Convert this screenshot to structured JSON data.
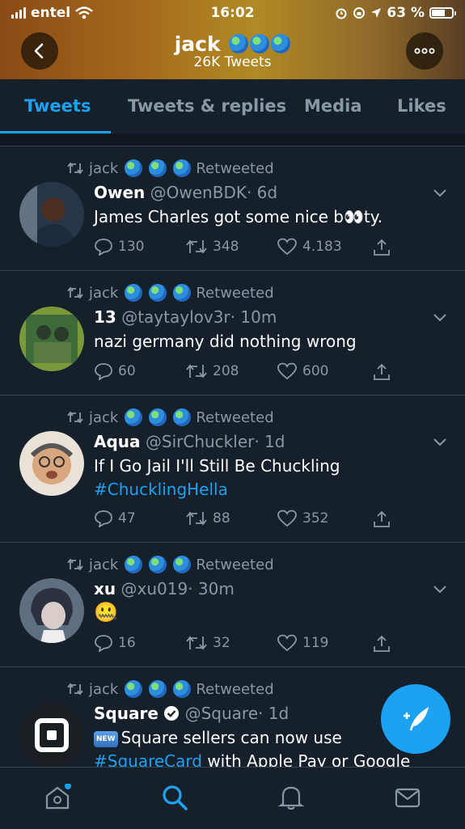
{
  "status_bar": {
    "carrier": "entel",
    "time": "16:02",
    "battery": "63 %"
  },
  "profile": {
    "name": "jack",
    "tweet_count": "26K Tweets"
  },
  "tabs": [
    "Tweets",
    "Tweets & replies",
    "Media",
    "Likes"
  ],
  "active_tab": "Tweets",
  "retweet_label": "Retweeted",
  "retweeter": "jack",
  "tweets": [
    {
      "name": "Owen",
      "handle": "@OwenBDK",
      "time": "· 6d",
      "text": "James Charles got some nice b👀ty.",
      "replies": "130",
      "retweets": "348",
      "likes": "4.183"
    },
    {
      "name": "13",
      "handle": "@taytaylov3r",
      "time": "· 10m",
      "text": "nazi germany did nothing wrong",
      "replies": "60",
      "retweets": "208",
      "likes": "600"
    },
    {
      "name": "Aqua",
      "handle": "@SirChuckler",
      "time": "· 1d",
      "text": "If I Go Jail I'll Still Be Chuckling",
      "hashtag": "#ChucklingHella",
      "replies": "47",
      "retweets": "88",
      "likes": "352"
    },
    {
      "name": "xu",
      "handle": "@xu019",
      "time": "· 30m",
      "text": "🤐",
      "replies": "16",
      "retweets": "32",
      "likes": "119"
    },
    {
      "name": "Square",
      "handle": "@Square",
      "time": "· 1d",
      "badge": "NEW",
      "text": "Square sellers can now use",
      "hashtag": "#SquareCard",
      "text2": " with Apple Pay or Google"
    }
  ],
  "colors": {
    "accent": "#1da1f2",
    "background": "#15202b",
    "muted": "#8899a6"
  }
}
